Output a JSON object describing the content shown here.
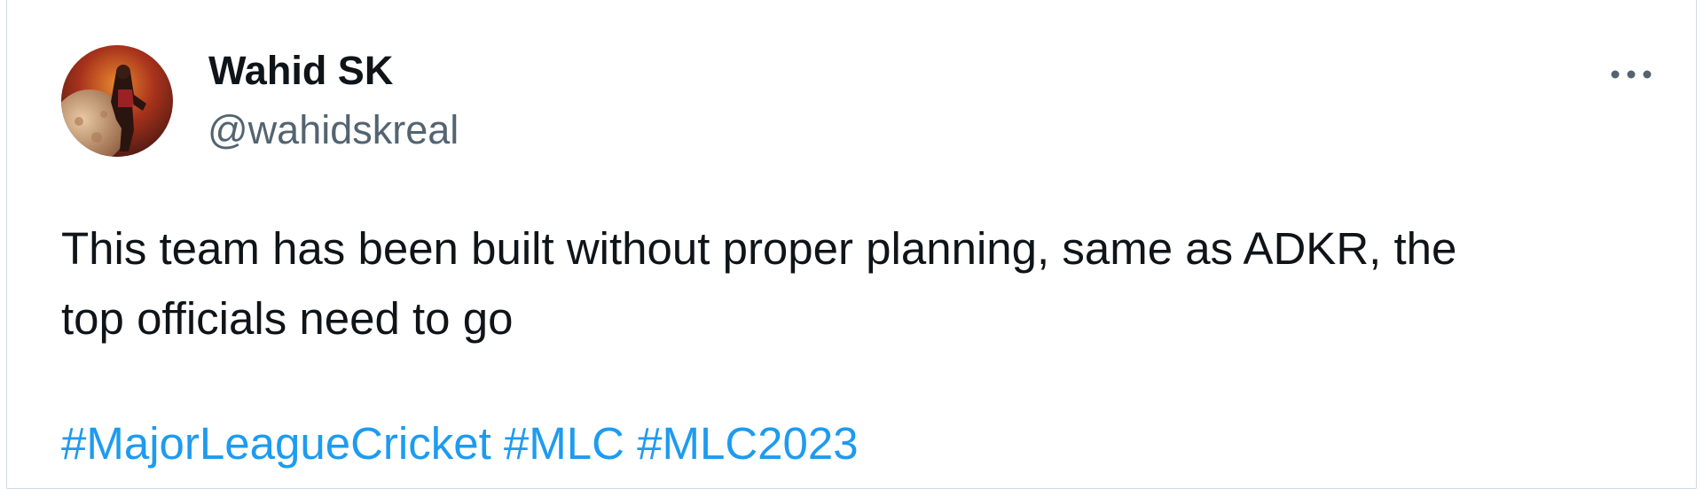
{
  "author": {
    "name": "Wahid SK",
    "handle": "@wahidskreal",
    "avatar": "profile-photo"
  },
  "menu": {
    "icon": "more-horizontal-icon"
  },
  "tweet": {
    "lines": [
      "This team has been built without proper planning, same as ADKR, the",
      "top officials need to go"
    ],
    "hashtags": [
      "#MajorLeagueCricket",
      "#MLC",
      "#MLC2023"
    ]
  },
  "colors": {
    "text": "#0f1419",
    "secondary_text": "#536471",
    "link": "#1d9bf0",
    "border": "#cfd9de"
  }
}
